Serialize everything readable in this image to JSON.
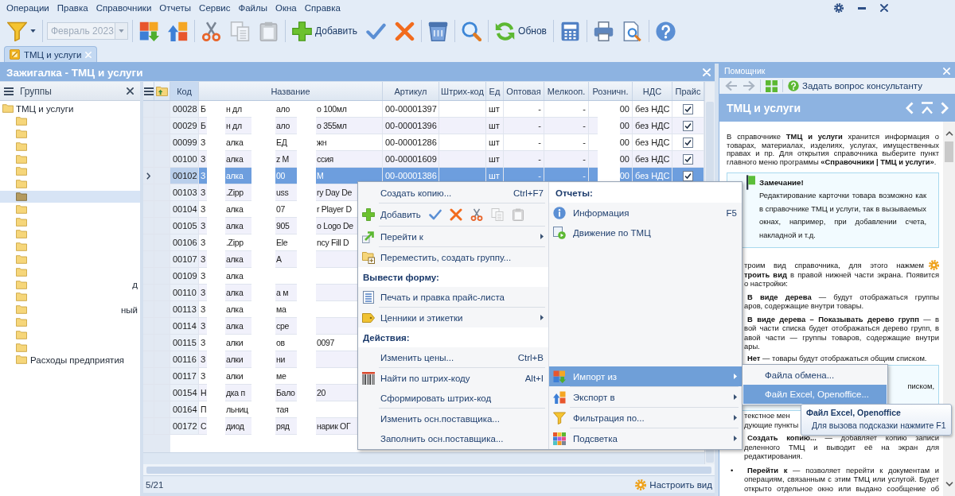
{
  "menu_bar": {
    "items": [
      "Операции",
      "Правка",
      "Справочники",
      "Отчеты",
      "Сервис",
      "Файлы",
      "Окна",
      "Справка"
    ]
  },
  "toolbar": {
    "groups": [
      [
        {
          "kind": "filter",
          "disabled": false
        }
      ],
      [
        {
          "kind": "period",
          "value": "Февраль 2023",
          "disabled": true
        }
      ],
      [
        {
          "kind": "import",
          "disabled": false
        },
        {
          "kind": "export",
          "disabled": false
        }
      ],
      [
        {
          "kind": "cut",
          "disabled": false
        },
        {
          "kind": "copy",
          "disabled": true
        },
        {
          "kind": "paste",
          "disabled": true
        }
      ],
      [
        {
          "kind": "add",
          "label": "Добавить",
          "disabled": false
        },
        {
          "kind": "apply",
          "disabled": false
        },
        {
          "kind": "cancel",
          "disabled": false
        }
      ],
      [
        {
          "kind": "delete",
          "disabled": false
        }
      ],
      [
        {
          "kind": "find",
          "disabled": false
        }
      ],
      [
        {
          "kind": "refresh",
          "label": "Обнов",
          "disabled": false
        }
      ],
      [
        {
          "kind": "calculator",
          "disabled": false
        }
      ],
      [
        {
          "kind": "print",
          "disabled": false
        },
        {
          "kind": "preview",
          "disabled": false
        }
      ],
      [
        {
          "kind": "help",
          "disabled": false
        }
      ]
    ]
  },
  "tabs": [
    {
      "label": "ТМЦ и услуги",
      "selected": true
    }
  ],
  "window": {
    "title": "Зажигалка - ТМЦ и услуги"
  },
  "groups_panel": {
    "title": "Группы",
    "tree": [
      {
        "label": "ТМЦ и услуги",
        "selected": false,
        "children": [
          {
            "selected": false
          },
          {
            "selected": false
          },
          {
            "selected": false
          },
          {
            "selected": false
          },
          {
            "selected": false
          },
          {
            "selected": false
          },
          {
            "selected": true
          },
          {
            "selected": false
          },
          {
            "selected": false
          },
          {
            "selected": false
          },
          {
            "selected": false
          },
          {
            "selected": false
          },
          {
            "selected": false
          },
          {
            "selected": false,
            "label_end": "д"
          },
          {
            "selected": false
          },
          {
            "selected": false,
            "label_end": "ный"
          },
          {
            "selected": false
          },
          {
            "selected": false
          },
          {
            "selected": false
          },
          {
            "selected": false,
            "label": "Расходы предприятия"
          }
        ]
      }
    ]
  },
  "table": {
    "columns": [
      {
        "label": "Код",
        "sorted": true
      },
      {
        "label": "Название",
        "sorted": false
      },
      {
        "label": "Артикул",
        "sorted": false
      },
      {
        "label": "Штрих-код",
        "sorted": false
      },
      {
        "label": "Ед",
        "sorted": false
      },
      {
        "label": "Оптовая",
        "sorted": false
      },
      {
        "label": "Мелкооп.",
        "sorted": false
      },
      {
        "label": "Розничн.",
        "sorted": false
      },
      {
        "label": "НДС",
        "sorted": false
      },
      {
        "label": "Прайс",
        "sorted": false
      }
    ],
    "rows": [
      {
        "selected": false,
        "code": "00028",
        "name_parts": [
          "Б",
          "н дл",
          "ало",
          "o 100мл"
        ],
        "article": "00-00001397",
        "unit": "шт",
        "wholesale": "-",
        "small_wholesale": "-",
        "retail": "00",
        "vat": "без НДС",
        "in_price_list": true
      },
      {
        "selected": false,
        "code": "00029",
        "name_parts": [
          "Б",
          "н дл",
          "ало",
          "o 355мл"
        ],
        "article": "00-00001396",
        "unit": "шт",
        "wholesale": "-",
        "small_wholesale": "-",
        "retail": "00",
        "vat": "без НДС",
        "in_price_list": true
      },
      {
        "selected": false,
        "code": "00099",
        "name_parts": [
          "З",
          "алка",
          "ЕД",
          "жн"
        ],
        "article": "00-00001286",
        "unit": "шт",
        "wholesale": "-",
        "small_wholesale": "-",
        "retail": "00",
        "vat": "без НДС",
        "in_price_list": true
      },
      {
        "selected": false,
        "code": "00100",
        "name_parts": [
          "З",
          "алка",
          "z M",
          "ссия"
        ],
        "article": "00-00001609",
        "unit": "шт",
        "wholesale": "-",
        "small_wholesale": "-",
        "retail": "00",
        "vat": "без НДС",
        "in_price_list": true
      },
      {
        "selected": true,
        "code": "00102",
        "name_parts": [
          "З",
          "алка",
          "00",
          "М"
        ],
        "article": "00-00001386",
        "unit": "шт",
        "wholesale": "-",
        "small_wholesale": "-",
        "retail": "00",
        "vat": "без НДС",
        "in_price_list": true
      },
      {
        "selected": false,
        "code": "00103",
        "name_parts": [
          "З",
          ".Zipp",
          "uss",
          "ry Day De"
        ]
      },
      {
        "selected": false,
        "code": "00104",
        "name_parts": [
          "З",
          "алка",
          "07",
          "r Player D"
        ]
      },
      {
        "selected": false,
        "code": "00105",
        "name_parts": [
          "З",
          "алка",
          "905",
          "o Logo De"
        ]
      },
      {
        "selected": false,
        "code": "00106",
        "name_parts": [
          "З",
          ".Zipp",
          "Ele",
          "ncy Fill D"
        ]
      },
      {
        "selected": false,
        "code": "00107",
        "name_parts": [
          "З",
          "алка",
          "А"
        ]
      },
      {
        "selected": false,
        "code": "00109",
        "name_parts": [
          "З",
          "алка"
        ]
      },
      {
        "selected": false,
        "code": "00110",
        "name_parts": [
          "З",
          "алка",
          "а м"
        ]
      },
      {
        "selected": false,
        "code": "00113",
        "name_parts": [
          "З",
          "алка",
          "ма"
        ]
      },
      {
        "selected": false,
        "code": "00114",
        "name_parts": [
          "З",
          "алка",
          "сре"
        ]
      },
      {
        "selected": false,
        "code": "00115",
        "name_parts": [
          "З",
          "алки",
          "ов",
          "0097"
        ]
      },
      {
        "selected": false,
        "code": "00116",
        "name_parts": [
          "З",
          "алки",
          "ни"
        ]
      },
      {
        "selected": false,
        "code": "00117",
        "name_parts": [
          "З",
          "алки",
          "ме"
        ]
      },
      {
        "selected": false,
        "code": "00154",
        "name_parts": [
          "Н",
          "дка п",
          "Бало",
          "20"
        ]
      },
      {
        "selected": false,
        "code": "00164",
        "name_parts": [
          "П",
          "льниц",
          "тая"
        ]
      },
      {
        "selected": false,
        "code": "00172",
        "name_parts": [
          "С",
          "диод",
          "ряд",
          "нарик ОГ"
        ]
      }
    ]
  },
  "status_bar": {
    "position": "5/21",
    "settings": "Настроить вид"
  },
  "context_menu": {
    "left": [
      {
        "kind": "item",
        "label": "Создать копию...",
        "shortcut": "Ctrl+F7",
        "submenu": false,
        "selected": false
      },
      {
        "kind": "separator"
      },
      {
        "kind": "tools",
        "label": "Добавить",
        "selected": false,
        "buttons": [
          {
            "kind": "apply",
            "disabled": false
          },
          {
            "kind": "cancel",
            "disabled": false
          },
          {
            "kind": "cut",
            "disabled": false
          },
          {
            "kind": "copy",
            "disabled": true
          },
          {
            "kind": "paste",
            "disabled": true
          }
        ]
      },
      {
        "kind": "separator"
      },
      {
        "kind": "item",
        "label": "Перейти к",
        "submenu": true,
        "selected": false
      },
      {
        "kind": "separator"
      },
      {
        "kind": "item",
        "label": "Переместить, создать группу...",
        "submenu": false,
        "selected": false
      },
      {
        "kind": "header",
        "label": "Вывести форму:"
      },
      {
        "kind": "item",
        "label": "Печать и правка прайс-листа",
        "submenu": false,
        "selected": false
      },
      {
        "kind": "separator"
      },
      {
        "kind": "item",
        "label": "Ценники и этикетки",
        "submenu": true,
        "selected": false
      },
      {
        "kind": "header",
        "label": "Действия:"
      },
      {
        "kind": "item",
        "label": "Изменить цены...",
        "shortcut": "Ctrl+B",
        "submenu": false,
        "selected": false
      },
      {
        "kind": "separator"
      },
      {
        "kind": "item",
        "label": "Найти по штрих-коду",
        "shortcut": "Alt+I",
        "submenu": false,
        "selected": false
      },
      {
        "kind": "item",
        "label": "Сформировать штрих-код",
        "submenu": false,
        "selected": false
      },
      {
        "kind": "separator"
      },
      {
        "kind": "item",
        "label": "Изменить осн.поставщика...",
        "submenu": false,
        "selected": false
      },
      {
        "kind": "item",
        "label": "Заполнить осн.поставщика...",
        "submenu": false,
        "selected": false
      }
    ],
    "right_top": [
      {
        "kind": "header",
        "label": "Отчеты:"
      },
      {
        "kind": "item",
        "label": "Информация",
        "shortcut": "F5",
        "submenu": false,
        "selected": false
      },
      {
        "kind": "item",
        "label": "Движение по ТМЦ",
        "submenu": false,
        "selected": false
      }
    ],
    "right_bottom": [
      {
        "kind": "item",
        "label": "Импорт из",
        "submenu": true,
        "selected": true
      },
      {
        "kind": "separator"
      },
      {
        "kind": "item",
        "label": "Экспорт в",
        "submenu": true,
        "selected": false
      },
      {
        "kind": "separator"
      },
      {
        "kind": "item",
        "label": "Фильтрация по...",
        "submenu": true,
        "selected": false
      },
      {
        "kind": "separator"
      },
      {
        "kind": "item",
        "label": "Подсветка",
        "submenu": true,
        "selected": false
      }
    ]
  },
  "submenu": [
    {
      "label": "Файла обмена...",
      "selected": false
    },
    {
      "label": "Файл Excel, Openoffice...",
      "selected": true
    }
  ],
  "tooltip": {
    "title": "Файл Excel, Openoffice",
    "text": "Для вызова подсказки нажмите F1"
  },
  "helper": {
    "title": "Помощник",
    "nav": [
      {
        "kind": "back",
        "disabled": true
      },
      {
        "kind": "forward",
        "disabled": true
      }
    ],
    "ask": "Задать вопрос консультанту",
    "heading": "ТМЦ и услуги",
    "blocks": [
      {
        "kind": "para",
        "text": "В справочнике **ТМЦ и услуги** хранится информация о товарах, материалах, изделиях, услугах, имущественных правах и пр. Для открытия справочника выберите пункт главного меню программы **«Справочники | ТМЦ и услуги»**."
      },
      {
        "kind": "note",
        "title": "Замечание!",
        "text": "Редактирование карточки товара возможно как в справочнике ТМЦ и услуги, так в вызываемых окнах, например, при добавлении счета, накладной и т.д."
      },
      {
        "kind": "line-icon",
        "text": "троим вид справочника, для этого нажмем"
      },
      {
        "kind": "line",
        "text": "**троить вид** в правой нижней части экрана. Появится"
      },
      {
        "kind": "line-end",
        "text": "о настройки:"
      },
      {
        "kind": "item-line",
        "text": "**В виде дерева** — будут отображаться группы"
      },
      {
        "kind": "line-end",
        "text": "аров, содержащие внутри товары."
      },
      {
        "kind": "item-line",
        "text": "**В виде дерева – Показывать дерево групп** — в"
      },
      {
        "kind": "line",
        "text": "вой части списка будет отображаться дерево групп, в"
      },
      {
        "kind": "line",
        "text": "авой части — группы товаров, содержащие внутри"
      },
      {
        "kind": "line-end",
        "text": "ары."
      },
      {
        "kind": "item-end",
        "text": "**Нет** — товары будут отображаться общим списком."
      },
      {
        "kind": "cut-note",
        "text": "писком,"
      },
      {
        "kind": "line-end",
        "text": "текстное мен"
      },
      {
        "kind": "line-end",
        "text": "дующие пункты"
      },
      {
        "kind": "item-line",
        "text": "**Создать копию...** — добавляет копию записи"
      },
      {
        "kind": "line",
        "text": "деленного ТМЦ и выводит её на экран для"
      },
      {
        "kind": "line-end",
        "text": "редактирования."
      },
      {
        "kind": "bullet-line",
        "bullet": "•",
        "text": "**Перейти к** — позволяет перейти к документам и"
      },
      {
        "kind": "line",
        "text": "операциям, связанным с этим ТМЦ или услугой. Будет"
      },
      {
        "kind": "line",
        "text": "открыто отдельное окно или выдано сообщение об"
      }
    ]
  }
}
